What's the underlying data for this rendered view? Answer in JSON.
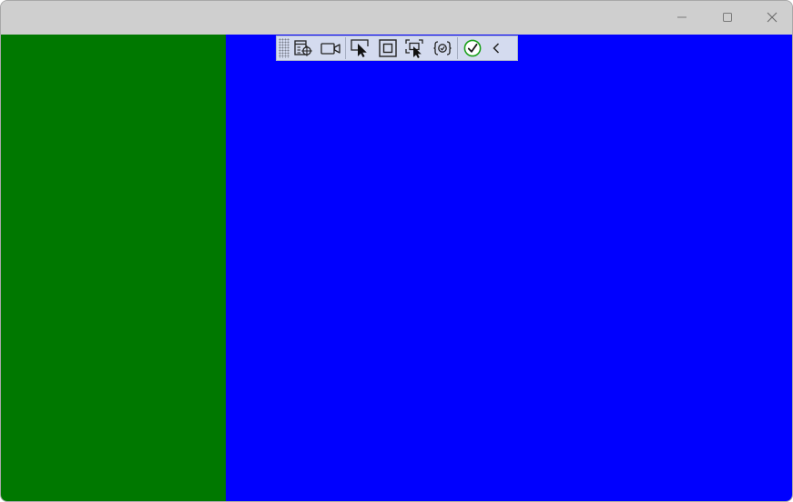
{
  "window": {
    "controls": {
      "minimize": "minimize-icon",
      "maximize": "maximize-icon",
      "close": "close-icon"
    }
  },
  "panes": {
    "left_color": "#007800",
    "right_color": "#0000ff"
  },
  "toolbar": {
    "items": [
      "go-to-live-visual-tree-icon",
      "record-icon",
      "select-element-icon",
      "display-layout-adorners-icon",
      "track-focused-element-icon",
      "binding-failures-icon",
      "hot-reload-status-icon",
      "collapse-toolbar-icon"
    ],
    "status_color": "#1aa01a"
  }
}
